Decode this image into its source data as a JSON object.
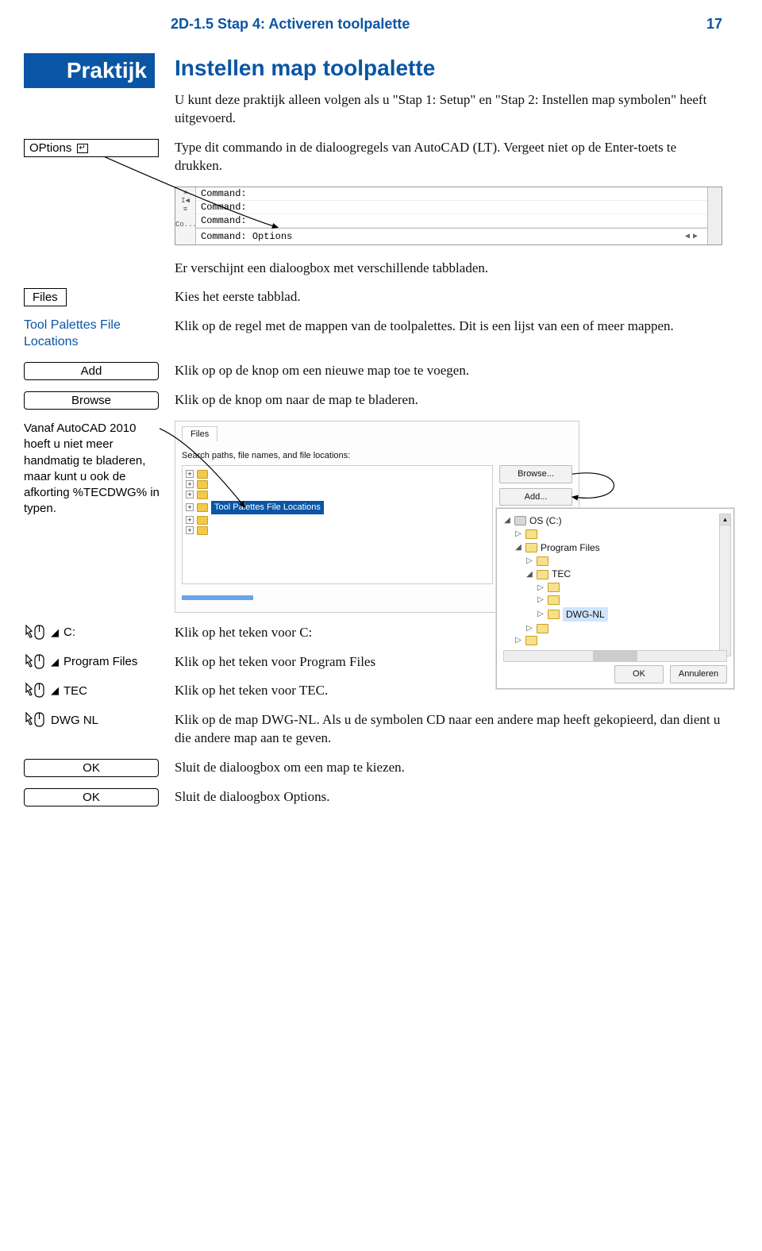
{
  "header": {
    "title": "2D-1.5 Stap 4: Activeren toolpalette",
    "pagenum": "17"
  },
  "praktijk": {
    "label": "Praktijk",
    "section_title": "Instellen map toolpalette",
    "intro": "U kunt deze praktijk alleen volgen als u \"Stap 1: Setup\" en \"Stap 2: Instellen map symbolen\" heeft uitgevoerd."
  },
  "options_cmd": {
    "box_text": "OPtions",
    "body": "Type dit commando in de dialoogregels van AutoCAD (LT). Vergeet niet op de Enter-toets te drukken."
  },
  "cmd_panel": {
    "sidebar_co": "Co...",
    "lines": [
      "Command:",
      "Command:",
      "Command:"
    ],
    "input_label": "Command:",
    "input_cmd": "Options",
    "scroll_l": "◀",
    "scroll_r": "▶"
  },
  "dialog_intro": "Er verschijnt een dialoogbox met verschillende tabbladen.",
  "files_tab": {
    "box": "Files",
    "body": "Kies het eerste tabblad."
  },
  "tpf": {
    "label": "Tool Palettes File Locations",
    "body": "Klik op de regel met de mappen van de toolpalettes. Dit is een lijst van een of meer mappen."
  },
  "add": {
    "box": "Add",
    "body": "Klik op op de knop om een nieuwe map toe te voegen."
  },
  "browse": {
    "box": "Browse",
    "body": "Klik op de knop om naar de map te bladeren."
  },
  "hand_note": "Vanaf AutoCAD 2010 hoeft u niet meer handmatig te bladeren, maar kunt u ook de afkorting %TECDWG% in typen.",
  "files_panel": {
    "tab": "Files",
    "search_label": "Search paths, file names, and file locations:",
    "selected_node": "Tool Palettes File Locations",
    "buttons": {
      "browse": "Browse...",
      "add": "Add..."
    },
    "browse_dialog": {
      "root": "OS (C:)",
      "pf": "Program Files",
      "tec": "TEC",
      "dwgnl": "DWG-NL",
      "ok": "OK",
      "cancel": "Annuleren"
    }
  },
  "click_steps": {
    "c": {
      "label": "C:",
      "body": "Klik op het teken voor C:"
    },
    "pf": {
      "label": "Program Files",
      "body": "Klik op het teken voor Program Files"
    },
    "tec": {
      "label": "TEC",
      "body": "Klik op het teken voor TEC."
    },
    "dwg": {
      "label": "DWG NL",
      "body": "Klik op de map DWG-NL. Als u de symbolen CD naar een andere map heeft gekopieerd, dan dient u die andere map aan te geven."
    }
  },
  "ok1": {
    "box": "OK",
    "body": "Sluit de dialoogbox om een map te kiezen."
  },
  "ok2": {
    "box": "OK",
    "body": "Sluit de dialoogbox Options."
  }
}
